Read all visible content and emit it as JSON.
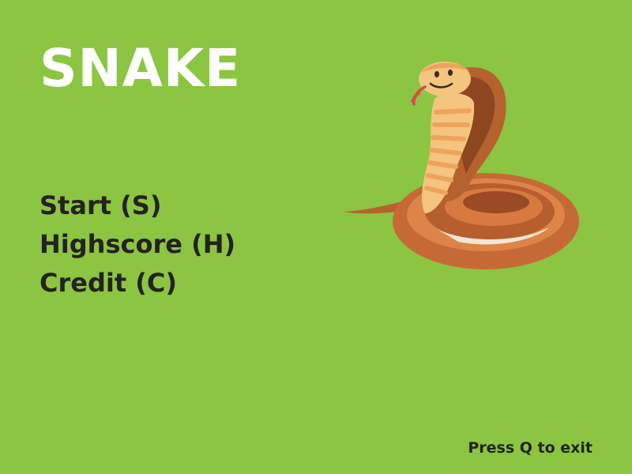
{
  "game": {
    "title": "SNAKE",
    "menu": [
      {
        "label": "Start (S)"
      },
      {
        "label": "Highscore (H)"
      },
      {
        "label": "Credit (C)"
      }
    ],
    "exit_hint": "Press Q to exit"
  },
  "mascot": {
    "icon": "cobra-icon"
  },
  "colors": {
    "background": "#8cc541",
    "title": "#ffffff",
    "text": "#24221f",
    "snake_dark": "#a0522d",
    "snake_mid": "#c2693a",
    "snake_light": "#f5c47e",
    "snake_stripe": "#eea35d"
  }
}
